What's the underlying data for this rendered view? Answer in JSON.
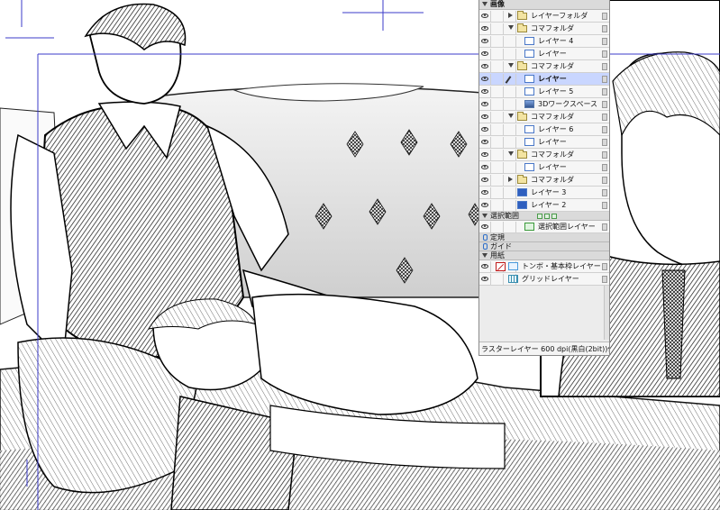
{
  "panel": {
    "root_label": "画像",
    "layers": [
      {
        "label": "レイヤーフォルダ",
        "type": "folder",
        "indent": 0,
        "expanded": false,
        "selected": false,
        "editing": false
      },
      {
        "label": "コマフォルダ",
        "type": "folder",
        "indent": 0,
        "expanded": true,
        "selected": false,
        "editing": false
      },
      {
        "label": "レイヤー 4",
        "type": "raster",
        "indent": 1,
        "expanded": null,
        "selected": false,
        "editing": false
      },
      {
        "label": "レイヤー",
        "type": "raster",
        "indent": 1,
        "expanded": null,
        "selected": false,
        "editing": false
      },
      {
        "label": "コマフォルダ",
        "type": "folder",
        "indent": 0,
        "expanded": true,
        "selected": false,
        "editing": false
      },
      {
        "label": "レイヤー",
        "type": "raster",
        "indent": 1,
        "expanded": null,
        "selected": true,
        "editing": true
      },
      {
        "label": "レイヤー 5",
        "type": "raster",
        "indent": 1,
        "expanded": null,
        "selected": false,
        "editing": false
      },
      {
        "label": "3Dワークスペース",
        "type": "3d",
        "indent": 1,
        "expanded": null,
        "selected": false,
        "editing": false
      },
      {
        "label": "コマフォルダ",
        "type": "folder",
        "indent": 0,
        "expanded": true,
        "selected": false,
        "editing": false
      },
      {
        "label": "レイヤー 6",
        "type": "raster",
        "indent": 1,
        "expanded": null,
        "selected": false,
        "editing": false
      },
      {
        "label": "レイヤー",
        "type": "raster",
        "indent": 1,
        "expanded": null,
        "selected": false,
        "editing": false
      },
      {
        "label": "コマフォルダ",
        "type": "folder",
        "indent": 0,
        "expanded": true,
        "selected": false,
        "editing": false
      },
      {
        "label": "レイヤー",
        "type": "raster",
        "indent": 1,
        "expanded": null,
        "selected": false,
        "editing": false
      },
      {
        "label": "コマフォルダ",
        "type": "folder",
        "indent": 0,
        "expanded": false,
        "selected": false,
        "editing": false
      },
      {
        "label": "レイヤー 3",
        "type": "raster-filled",
        "indent": 0,
        "expanded": null,
        "selected": false,
        "editing": false
      },
      {
        "label": "レイヤー 2",
        "type": "raster-filled",
        "indent": 0,
        "expanded": null,
        "selected": false,
        "editing": false
      }
    ],
    "selection_section": "選択範囲",
    "selection_layer": "選択範囲レイヤー",
    "ruler_section": "定規",
    "guide_section": "ガイド",
    "paper_section": "用紙",
    "paper_layers": [
      {
        "label": "トンボ・基本枠レイヤー",
        "icon": "ruler-frame"
      },
      {
        "label": "グリッドレイヤー",
        "icon": "grid"
      }
    ],
    "status": "ラスターレイヤー 600 dpi(黒白(2bit))仕..."
  },
  "colors": {
    "selected_row": "#c9d6ff",
    "panel_bg": "#ececec",
    "frame_guide": "#3b3bc8",
    "ink": "#111111"
  }
}
